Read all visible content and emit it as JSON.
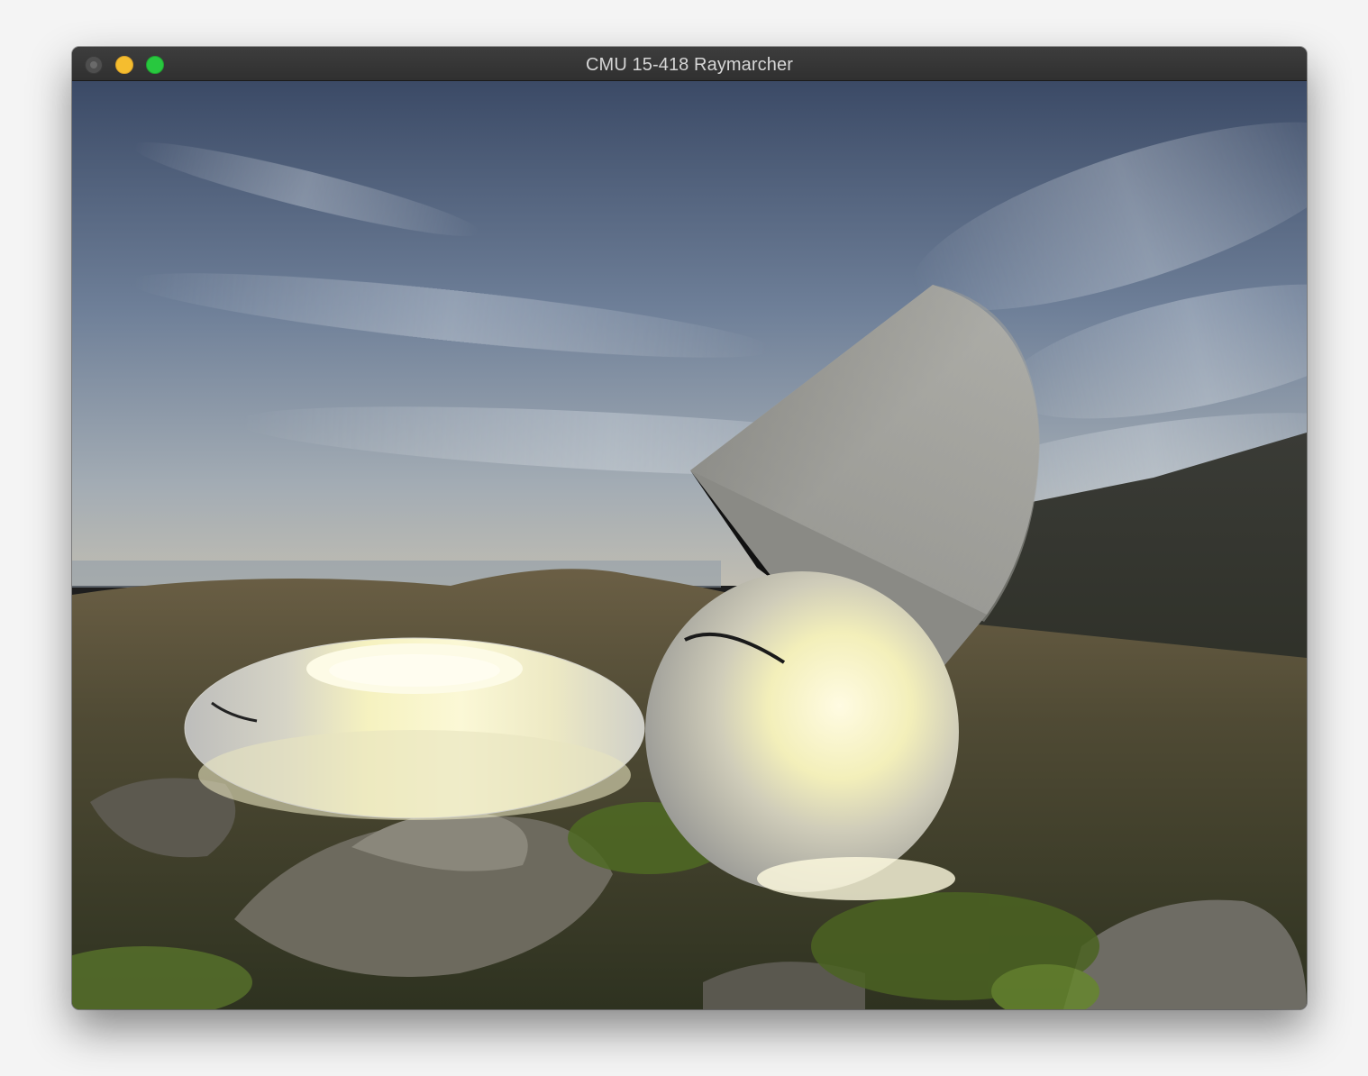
{
  "window": {
    "title": "CMU 15-418 Raymarcher",
    "controls": [
      "close",
      "minimize",
      "zoom"
    ]
  },
  "scene": {
    "objects": [
      "torus",
      "sphere",
      "cone"
    ],
    "background": "environment-map"
  },
  "colors": {
    "minimize": "#f5bd2f",
    "zoom": "#28c83f",
    "close_disabled": "#4e4e4e",
    "titlebar": "#363636"
  }
}
